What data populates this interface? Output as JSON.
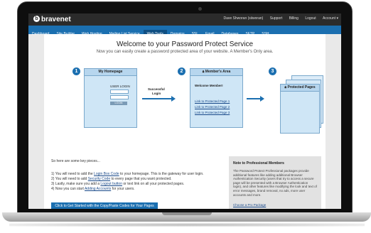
{
  "topbar": {
    "logo": "bravenet",
    "user": "Dave Shworan (siiworan)",
    "links": [
      "Support",
      "Billing",
      "Logout",
      "Account ▾"
    ]
  },
  "nav": {
    "items": [
      "Dashboard",
      "Site Builder",
      "Web Hosting",
      "Mailing List Service",
      "Web Tools",
      "Domains",
      "SSL",
      "Email",
      "Databases",
      "SFTP",
      "SSH"
    ],
    "active_index": 4
  },
  "main": {
    "title": "Welcome to your Password Protect Service",
    "subtitle": "Now you can easily create a password protected area of your website.   A Member's Only area."
  },
  "steps": {
    "numbers": [
      "1",
      "2",
      "3"
    ],
    "homepage": {
      "title": "My Homepage",
      "login_label": "USER LOGIN",
      "button": "LOGIN"
    },
    "arrow_label_1": "Successful",
    "arrow_label_2": "Login",
    "members": {
      "title": "Member's Area",
      "welcome": "Welcome Member!",
      "links": [
        "Link to Protected Page 1",
        "Link to Protected Page 2",
        "Link to Protected Page 3"
      ]
    },
    "protected": {
      "title": "Protected Pages"
    }
  },
  "keypieces": {
    "intro": "So here are some key pieces...",
    "items": [
      {
        "pre": "1)  You will need to add the ",
        "link": "Login Box Code",
        "post": " to your homepage. This is the gateway for user login."
      },
      {
        "pre": "2)  You will need to add ",
        "link": "Security Code",
        "post": " to every page that you want protected."
      },
      {
        "pre": "3)  Lastly, make sure you add a ",
        "link": "Logout button",
        "post": " or text link on all your protected pages."
      },
      {
        "pre": "4)  Now you can start ",
        "link": "Adding Accounts",
        "post": " for your users."
      }
    ],
    "cta": "Click to Get Started with the Copy/Paste Codes for Your Pages"
  },
  "note": {
    "title": "Note to Professional Members",
    "body": "The Password Protect Professional packages provide additional features like adding additional Browser Authentication Security (users that try to access a secure page will be presented with a Browser Authentication login), and other features like modifying the look and text of error messages, brand removal, no ads, more user accounts and more.",
    "link": "Choose a Pro Package"
  },
  "colors": {
    "accent": "#1b6fb0",
    "nav_active": "#0f4f83",
    "topbar": "#2b2b2b",
    "panel": "#cfe6f6"
  }
}
